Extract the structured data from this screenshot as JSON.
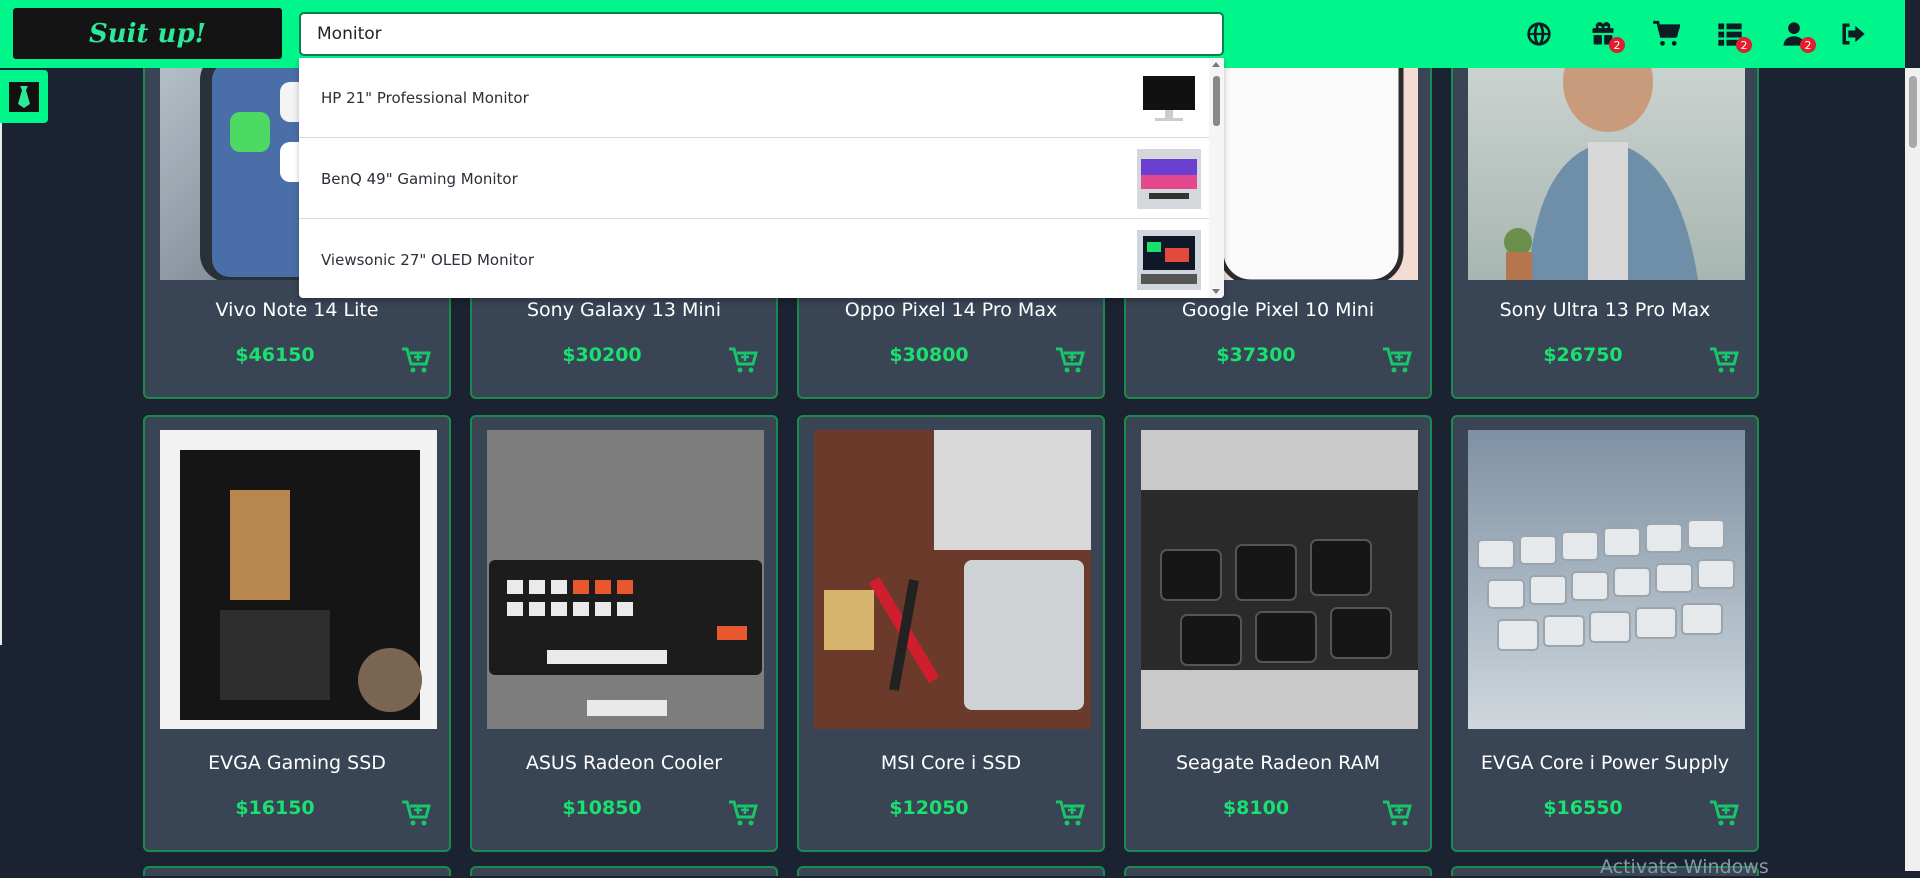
{
  "brand": {
    "name": "Suit up!"
  },
  "search": {
    "value": "Monitor",
    "placeholder": ""
  },
  "nav": {
    "icons": [
      "globe-icon",
      "gift-icon",
      "cart-icon",
      "list-icon",
      "user-icon",
      "logout-icon"
    ],
    "badges": {
      "gifts": "2",
      "orders": "2",
      "user": "2"
    }
  },
  "suggestions": [
    {
      "label": "HP 21\" Professional Monitor",
      "thumb": "monitor-black"
    },
    {
      "label": "BenQ 49\" Gaming Monitor",
      "thumb": "monitor-colorful"
    },
    {
      "label": "Viewsonic 27\" OLED Monitor",
      "thumb": "monitor-desk"
    }
  ],
  "products_row1": [
    {
      "name": "Vivo Note 14 Lite",
      "price": "$46150"
    },
    {
      "name": "Sony Galaxy 13 Mini",
      "price": "$30200"
    },
    {
      "name": "Oppo Pixel 14 Pro Max",
      "price": "$30800"
    },
    {
      "name": "Google Pixel 10 Mini",
      "price": "$37300"
    },
    {
      "name": "Sony Ultra 13 Pro Max",
      "price": "$26750"
    }
  ],
  "products_row2": [
    {
      "name": "EVGA Gaming SSD",
      "price": "$16150"
    },
    {
      "name": "ASUS Radeon Cooler",
      "price": "$10850"
    },
    {
      "name": "MSI Core i SSD",
      "price": "$12050"
    },
    {
      "name": "Seagate Radeon RAM",
      "price": "$8100"
    },
    {
      "name": "EVGA Core i Power Supply",
      "price": "$16550"
    }
  ],
  "watermark": "Activate Windows",
  "colors": {
    "topbar": "#00f58a",
    "background": "#1b2232",
    "card": "#394454",
    "price": "#19e06f",
    "badge": "#e11d2f"
  }
}
